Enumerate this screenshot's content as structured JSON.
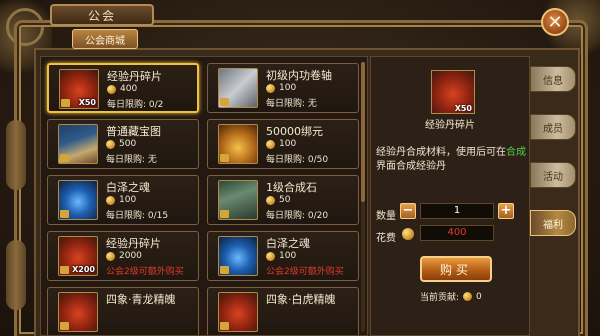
{
  "window": {
    "title": "公会",
    "close_label": "✕"
  },
  "sub_tab": {
    "label": "公会商城"
  },
  "items": [
    {
      "name": "经验丹碎片",
      "price": "400",
      "limit_label": "每日限购: 0/2",
      "qty": "X50",
      "icon": "red-orb-icon",
      "selected": true
    },
    {
      "name": "初级内功卷轴",
      "price": "100",
      "limit_label": "每日限购: 无",
      "qty": "",
      "icon": "scroll-icon",
      "selected": false
    },
    {
      "name": "普通藏宝图",
      "price": "500",
      "limit_label": "每日限购: 无",
      "qty": "",
      "icon": "treasure-map-icon",
      "selected": false
    },
    {
      "name": "50000绑元",
      "price": "100",
      "limit_label": "每日限购: 0/50",
      "qty": "",
      "icon": "treasure-chest-icon",
      "selected": false
    },
    {
      "name": "白泽之魂",
      "price": "100",
      "limit_label": "每日限购: 0/15",
      "qty": "",
      "icon": "blue-spirit-icon",
      "selected": false
    },
    {
      "name": "1级合成石",
      "price": "50",
      "limit_label": "每日限购: 0/20",
      "qty": "",
      "icon": "stone-icon",
      "selected": false
    },
    {
      "name": "经验丹碎片",
      "price": "2000",
      "limit_label": "公会2级可额外购买",
      "qty": "X200",
      "icon": "red-orb-icon",
      "selected": false,
      "red": true
    },
    {
      "name": "白泽之魂",
      "price": "100",
      "limit_label": "公会2级可额外购买",
      "qty": "",
      "icon": "blue-spirit-icon",
      "selected": false,
      "red": true
    },
    {
      "name": "四象·青龙精魄",
      "price": "",
      "limit_label": "",
      "qty": "",
      "icon": "orb-icon",
      "selected": false
    },
    {
      "name": "四象·白虎精魄",
      "price": "",
      "limit_label": "",
      "qty": "",
      "icon": "orb-icon",
      "selected": false
    }
  ],
  "detail": {
    "name": "经验丹碎片",
    "qty": "X50",
    "desc_before": "经验丹合成材料，使用后可在",
    "desc_highlight": "合成",
    "desc_after": "界面合成经验丹",
    "qty_label": "数量",
    "qty_value": "1",
    "cost_label": "花费",
    "cost_value": "400",
    "buy_label": "购买",
    "contrib_label": "当前贡献:",
    "contrib_value": "0"
  },
  "side_tabs": [
    "信息",
    "成员",
    "活动",
    "福利"
  ],
  "colors": {
    "highlight_green": "#4fd24a",
    "price_red": "#e23a2a",
    "selected_border": "#f2c23e"
  }
}
